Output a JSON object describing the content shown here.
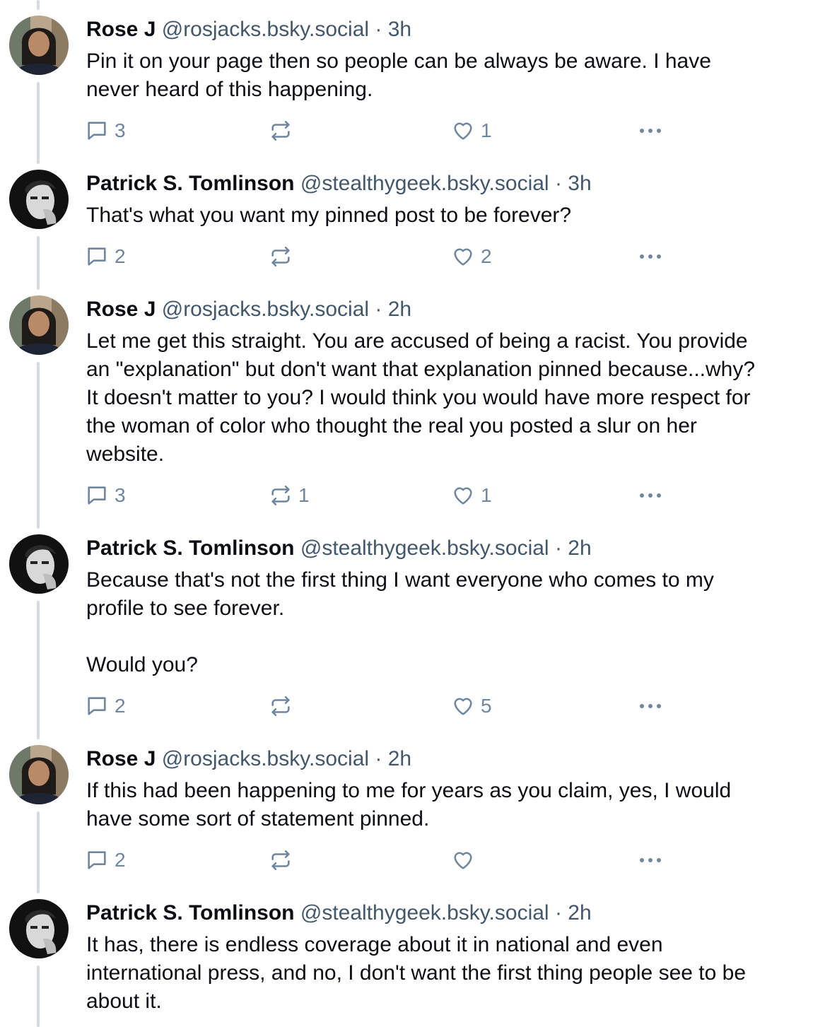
{
  "posts": [
    {
      "name": "Rose J",
      "handle": "@rosjacks.bsky.social",
      "sep": "·",
      "time": "3h",
      "text": "Pin it on your page then so people can be always be aware. I have\nnever heard of this happening.",
      "replies": "3",
      "reposts": "",
      "likes": "1",
      "avatar": "rose-avatar"
    },
    {
      "name": "Patrick S. Tomlinson",
      "handle": "@stealthygeek.bsky.social",
      "sep": "·",
      "time": "3h",
      "text": "That's what you want my pinned post to be forever?",
      "replies": "2",
      "reposts": "",
      "likes": "2",
      "avatar": "patrick-avatar"
    },
    {
      "name": "Rose J",
      "handle": "@rosjacks.bsky.social",
      "sep": "·",
      "time": "2h",
      "text": "Let me get this straight. You are accused of being a racist. You provide\nan \"explanation\" but don't want that explanation pinned because...why?\nIt doesn't matter to you? I would think you would have more respect for\nthe woman of color who thought the real you posted a slur on her\nwebsite.",
      "replies": "3",
      "reposts": "1",
      "likes": "1",
      "avatar": "rose-avatar"
    },
    {
      "name": "Patrick S. Tomlinson",
      "handle": "@stealthygeek.bsky.social",
      "sep": "·",
      "time": "2h",
      "text": "Because that's not the first thing I want everyone who comes to my\nprofile to see forever.\n\nWould you?",
      "replies": "2",
      "reposts": "",
      "likes": "5",
      "avatar": "patrick-avatar"
    },
    {
      "name": "Rose J",
      "handle": "@rosjacks.bsky.social",
      "sep": "·",
      "time": "2h",
      "text": "If this had been happening to me for years as you claim, yes, I would\nhave some sort of statement pinned.",
      "replies": "2",
      "reposts": "",
      "likes": "",
      "avatar": "rose-avatar"
    },
    {
      "name": "Patrick S. Tomlinson",
      "handle": "@stealthygeek.bsky.social",
      "sep": "·",
      "time": "2h",
      "text": "It has, there is endless coverage about it in national and even\ninternational press, and no, I don't want the first thing people see to be\nabout it.",
      "replies": "",
      "reposts": "",
      "likes": "",
      "avatar": "patrick-avatar"
    }
  ],
  "colors": {
    "text": "#0b0f14",
    "secondary": "#42576c",
    "icon": "#6f869f",
    "thread_line": "#d4dbe2"
  },
  "icons": {
    "reply": "reply-icon",
    "repost": "repost-icon",
    "like": "heart-icon",
    "more": "more-options-icon"
  }
}
